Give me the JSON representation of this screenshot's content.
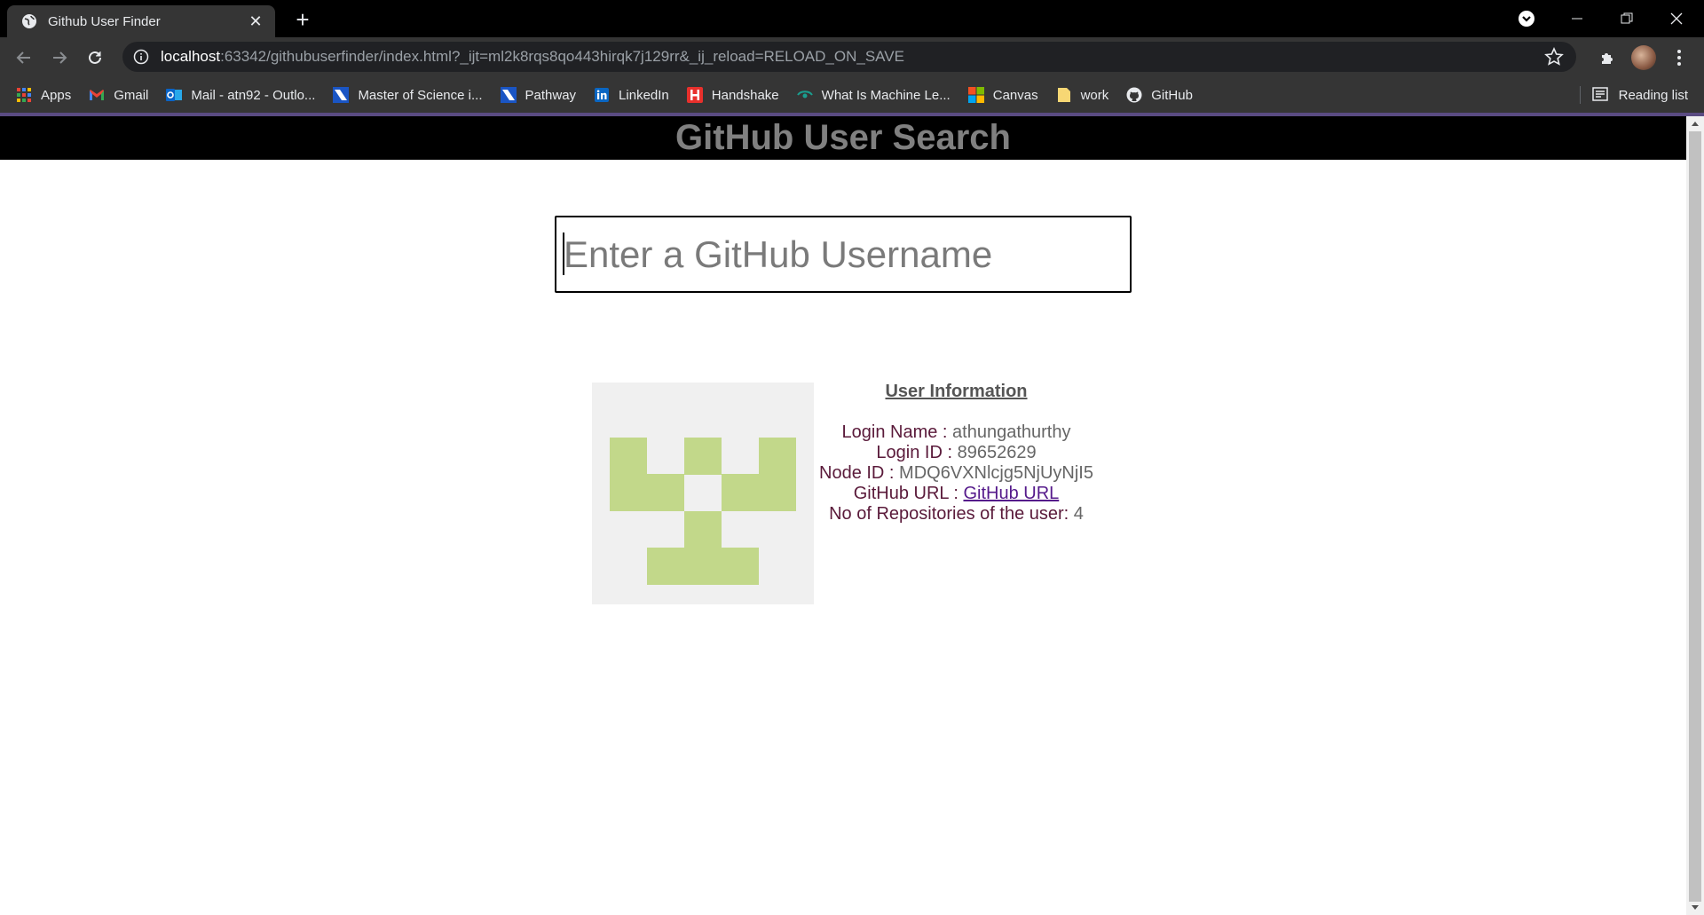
{
  "browser": {
    "tab": {
      "title": "Github User Finder",
      "favicon": "globe-icon"
    },
    "url": {
      "host": "localhost",
      "rest": ":63342/githubuserfinder/index.html?_ijt=ml2k8rqs8qo443hirqk7j129rr&_ij_reload=RELOAD_ON_SAVE"
    },
    "bookmarks": [
      {
        "label": "Apps",
        "icon": "apps-grid-icon"
      },
      {
        "label": "Gmail",
        "icon": "gmail-icon"
      },
      {
        "label": "Mail - atn92 - Outlo...",
        "icon": "outlook-icon"
      },
      {
        "label": "Master of Science i...",
        "icon": "bookmark-site-icon"
      },
      {
        "label": "Pathway",
        "icon": "bookmark-site-icon"
      },
      {
        "label": "LinkedIn",
        "icon": "linkedin-icon"
      },
      {
        "label": "Handshake",
        "icon": "handshake-icon"
      },
      {
        "label": "What Is Machine Le...",
        "icon": "eye-icon"
      },
      {
        "label": "Canvas",
        "icon": "windows-icon"
      },
      {
        "label": "work",
        "icon": "folder-icon"
      },
      {
        "label": "GitHub",
        "icon": "github-icon"
      }
    ],
    "reading_list": "Reading list"
  },
  "page": {
    "title": "GitHub User Search",
    "search": {
      "placeholder": "Enter a GitHub Username",
      "value": ""
    },
    "user_info": {
      "heading": "User Information",
      "login_name_label": "Login Name : ",
      "login_name": "athungathurthy",
      "login_id_label": "Login ID : ",
      "login_id": "89652629",
      "node_id_label": "Node ID : ",
      "node_id": "MDQ6VXNlcjg5NjUyNjI5",
      "github_url_label": "GitHub URL : ",
      "github_url_link": "GitHub URL",
      "repos_label": "No of Repositories of the user: ",
      "repos": "4"
    },
    "identicon": {
      "color": "#c2d88a",
      "background": "#f0f0f0"
    }
  }
}
